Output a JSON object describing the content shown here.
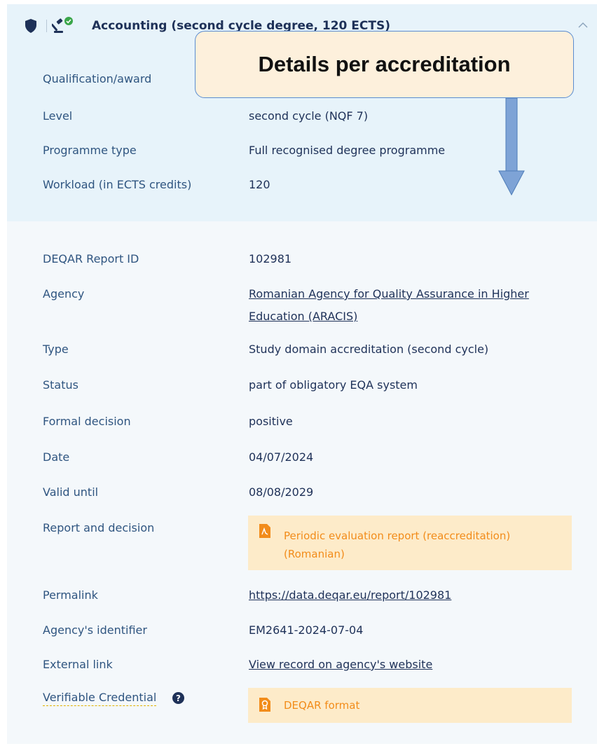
{
  "header": {
    "title": "Accounting (second cycle degree, 120 ECTS)",
    "icons": [
      "shield-icon",
      "gavel-icon",
      "check-circle-icon",
      "chevron-up-icon"
    ]
  },
  "callout": {
    "text": "Details per accreditation"
  },
  "programme": {
    "rows": [
      {
        "label": "Qualification/award",
        "value": ""
      },
      {
        "label": "Level",
        "value": "second cycle (NQF 7)"
      },
      {
        "label": "Programme type",
        "value": "Full recognised degree programme"
      },
      {
        "label": "Workload (in ECTS credits)",
        "value": "120"
      }
    ]
  },
  "report": {
    "report_id_label": "DEQAR Report ID",
    "report_id": "102981",
    "agency_label": "Agency",
    "agency": "Romanian Agency for Quality Assurance in Higher Education (ARACIS)",
    "type_label": "Type",
    "type": "Study domain accreditation (second cycle)",
    "status_label": "Status",
    "status": "part of obligatory EQA system",
    "formal_decision_label": "Formal decision",
    "formal_decision": "positive",
    "date_label": "Date",
    "date": "04/07/2024",
    "valid_until_label": "Valid until",
    "valid_until": "08/08/2029",
    "report_decision_label": "Report and decision",
    "report_file": "Periodic evaluation report (reaccreditation) (Romanian)",
    "report_file_icon": "pdf-icon",
    "permalink_label": "Permalink",
    "permalink": "https://data.deqar.eu/report/102981",
    "agency_identifier_label": "Agency's identifier",
    "agency_identifier": "EM2641-2024-07-04",
    "external_link_label": "External link",
    "external_link": "View record on agency's website",
    "verifiable_credential_label": "Verifiable Credential",
    "verifiable_credential_format": "DEQAR format",
    "verifiable_credential_icon": "certificate-icon"
  },
  "colors": {
    "top_panel": "#e7f3fa",
    "card": "#f4f8fb",
    "text": "#1e3158",
    "label": "#2f5580",
    "doc_box": "#fdebc9",
    "doc_text": "#f28c1a",
    "check_green": "#3aa64a"
  }
}
